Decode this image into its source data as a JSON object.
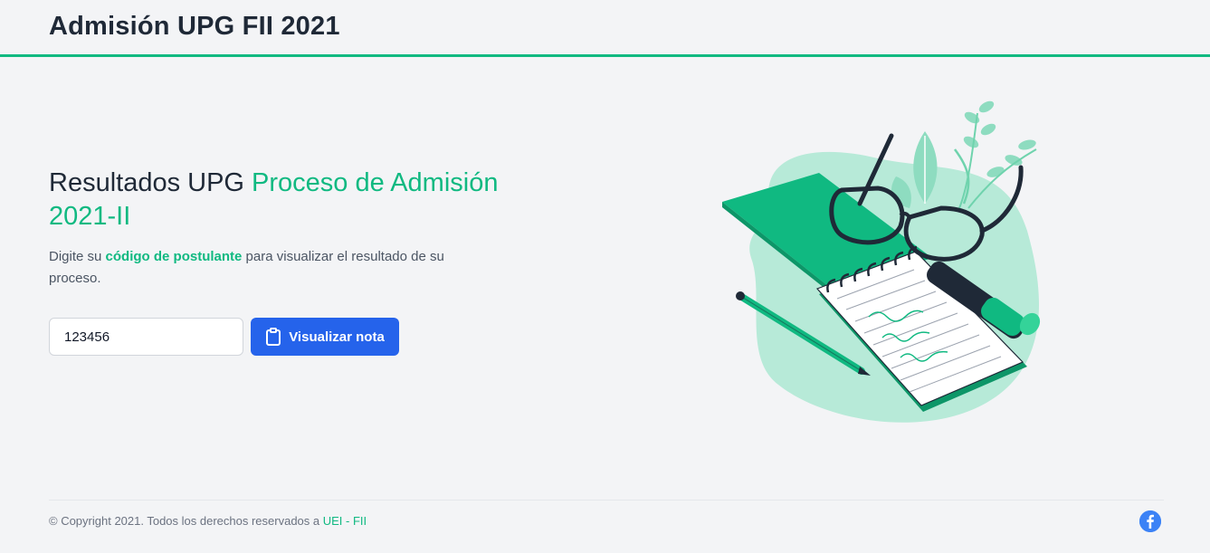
{
  "header": {
    "title": "Admisión UPG FII 2021"
  },
  "hero": {
    "title_plain": "Resultados UPG ",
    "title_accent": "Proceso de Admisión 2021-II",
    "description_before": "Digite su ",
    "description_accent": "código de postulante",
    "description_after": " para visualizar el resultado de su proceso."
  },
  "form": {
    "code_value": "123456",
    "submit_label": "Visualizar nota",
    "submit_icon": "clipboard-icon"
  },
  "illustration": {
    "icon": "notebook-glasses-illustration"
  },
  "footer": {
    "copyright_text": "© Copyright 2021. Todos los derechos reservados a ",
    "link_label": "UEI - FII",
    "social_icon": "facebook-icon"
  },
  "colors": {
    "accent": "#10b981",
    "primary_button": "#2563eb",
    "background": "#f3f4f6",
    "facebook": "#3b82f6"
  }
}
